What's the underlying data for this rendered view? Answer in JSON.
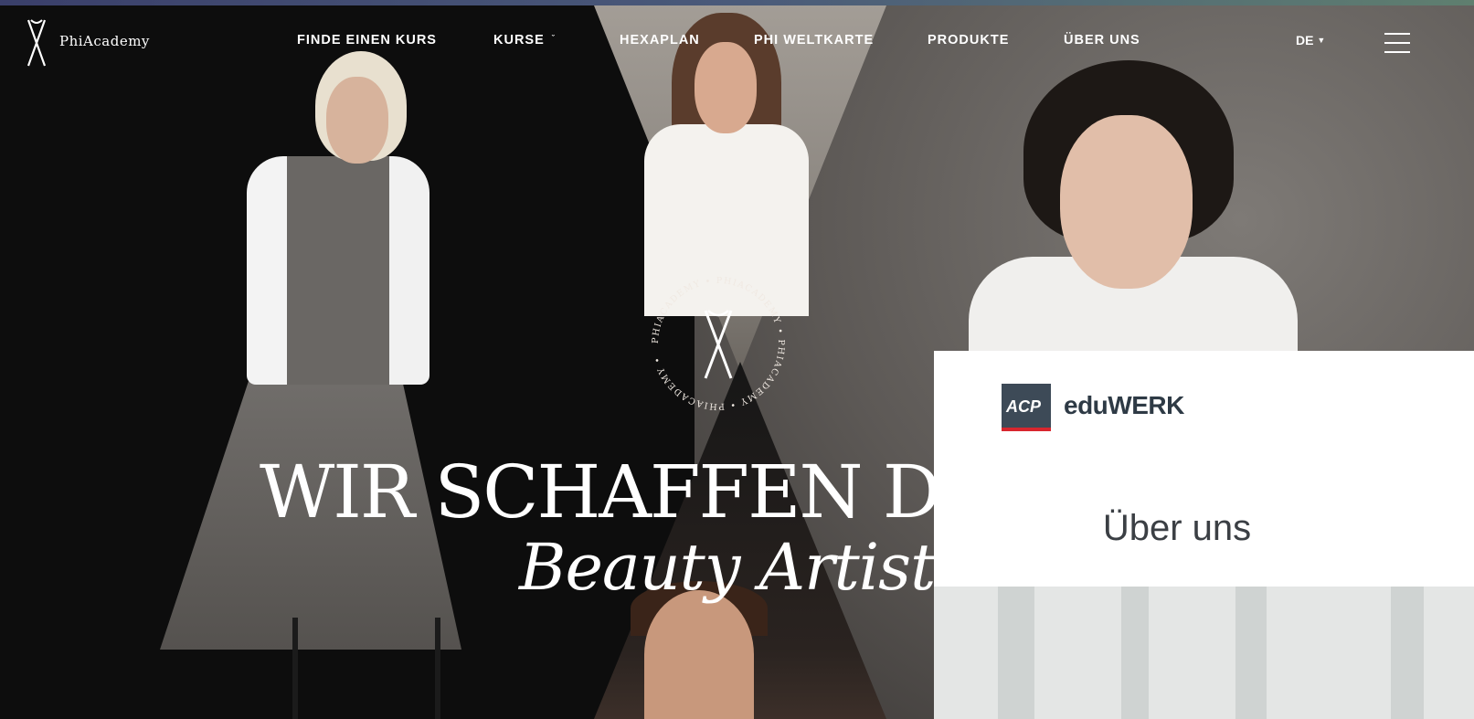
{
  "brand": {
    "name": "PhiAcademy"
  },
  "nav": {
    "items": [
      {
        "label": "FINDE EINEN KURS",
        "has_dropdown": false
      },
      {
        "label": "KURSE",
        "has_dropdown": true
      },
      {
        "label": "HEXAPLAN",
        "has_dropdown": false
      },
      {
        "label": "PHI WELTKARTE",
        "has_dropdown": false
      },
      {
        "label": "PRODUKTE",
        "has_dropdown": false
      },
      {
        "label": "ÜBER UNS",
        "has_dropdown": false
      }
    ],
    "language": "DE",
    "menu_icon": "hamburger-icon"
  },
  "hero": {
    "headline": "WIR SCHAFFEN DIE B",
    "subline": "Beauty Artists",
    "seal_text": "PHIACADEMY • PHIACADEMY • PHIACADEMY • PHIACADEMY •"
  },
  "popup": {
    "badge": "ACP",
    "brand": "eduWERK",
    "title": "Über uns"
  },
  "colors": {
    "nav_text": "#ffffff",
    "acp_badge": "#3d4a57",
    "acp_stripe": "#d8262e",
    "brand_text": "#2e3a45"
  }
}
